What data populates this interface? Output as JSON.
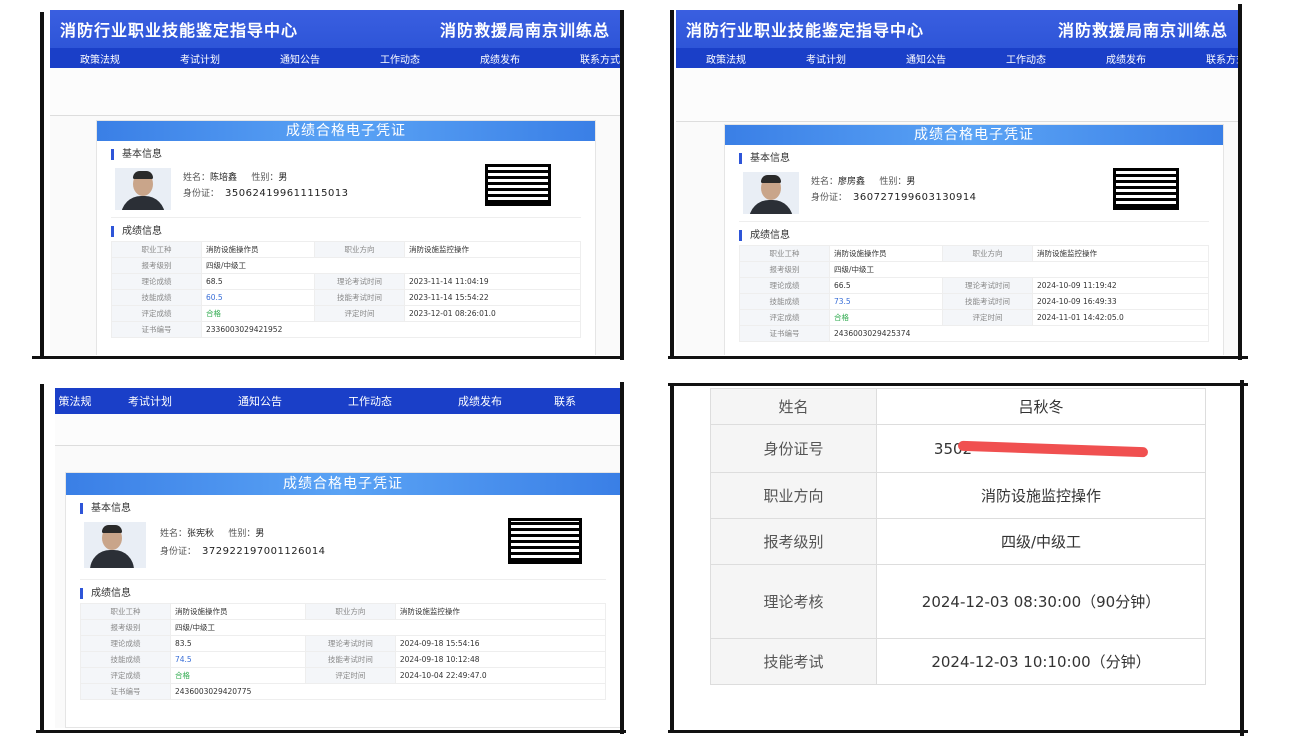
{
  "banner": {
    "left": "消防行业职业技能鉴定指导中心",
    "right": "消防救援局南京训练总"
  },
  "nav": [
    "政策法规",
    "考试计划",
    "通知公告",
    "工作动态",
    "成绩发布",
    "联系方式"
  ],
  "nav_p3": [
    "策法规",
    "考试计划",
    "通知公告",
    "工作动态",
    "成绩发布",
    "联系"
  ],
  "card_title": "成绩合格电子凭证",
  "labels": {
    "basic": "基本信息",
    "score": "成绩信息",
    "name": "姓名：",
    "gender": "性别：",
    "id": "身份证：",
    "job": "职业工种",
    "direction": "职业方向",
    "level": "报考级别",
    "theory": "理论成绩",
    "theory_time": "理论考试时间",
    "skill": "技能成绩",
    "skill_time": "技能考试时间",
    "eval": "评定成绩",
    "eval_time": "评定时间",
    "cert": "证书编号"
  },
  "records": [
    {
      "name": "陈培鑫",
      "gender": "男",
      "id": "350624199611115013",
      "job": "消防设施操作员",
      "direction": "消防设施监控操作",
      "level": "四级/中级工",
      "theory": "68.5",
      "theory_time": "2023-11-14 11:04:19",
      "skill": "60.5",
      "skill_time": "2023-11-14 15:54:22",
      "eval": "合格",
      "eval_time": "2023-12-01 08:26:01.0",
      "cert": "2336003029421952"
    },
    {
      "name": "廖房鑫",
      "gender": "男",
      "id": "360727199603130914",
      "job": "消防设施操作员",
      "direction": "消防设施监控操作",
      "level": "四级/中级工",
      "theory": "66.5",
      "theory_time": "2024-10-09 11:19:42",
      "skill": "73.5",
      "skill_time": "2024-10-09 16:49:33",
      "eval": "合格",
      "eval_time": "2024-11-01 14:42:05.0",
      "cert": "2436003029425374"
    },
    {
      "name": "张宪秋",
      "gender": "男",
      "id": "372922197001126014",
      "job": "消防设施操作员",
      "direction": "消防设施监控操作",
      "level": "四级/中级工",
      "theory": "83.5",
      "theory_time": "2024-09-18 15:54:16",
      "skill": "74.5",
      "skill_time": "2024-09-18 10:12:48",
      "eval": "合格",
      "eval_time": "2024-10-04 22:49:47.0",
      "cert": "2436003029420775"
    }
  ],
  "exam_table": {
    "rows": [
      {
        "label": "姓名",
        "value": "吕秋冬"
      },
      {
        "label": "身份证号",
        "value": "3502"
      },
      {
        "label": "职业方向",
        "value": "消防设施监控操作"
      },
      {
        "label": "报考级别",
        "value": "四级/中级工"
      },
      {
        "label": "理论考核",
        "value": "2024-12-03 08:30:00（90分钟）"
      },
      {
        "label": "技能考试",
        "value": "2024-12-03 10:10:00（分钟）"
      }
    ]
  }
}
